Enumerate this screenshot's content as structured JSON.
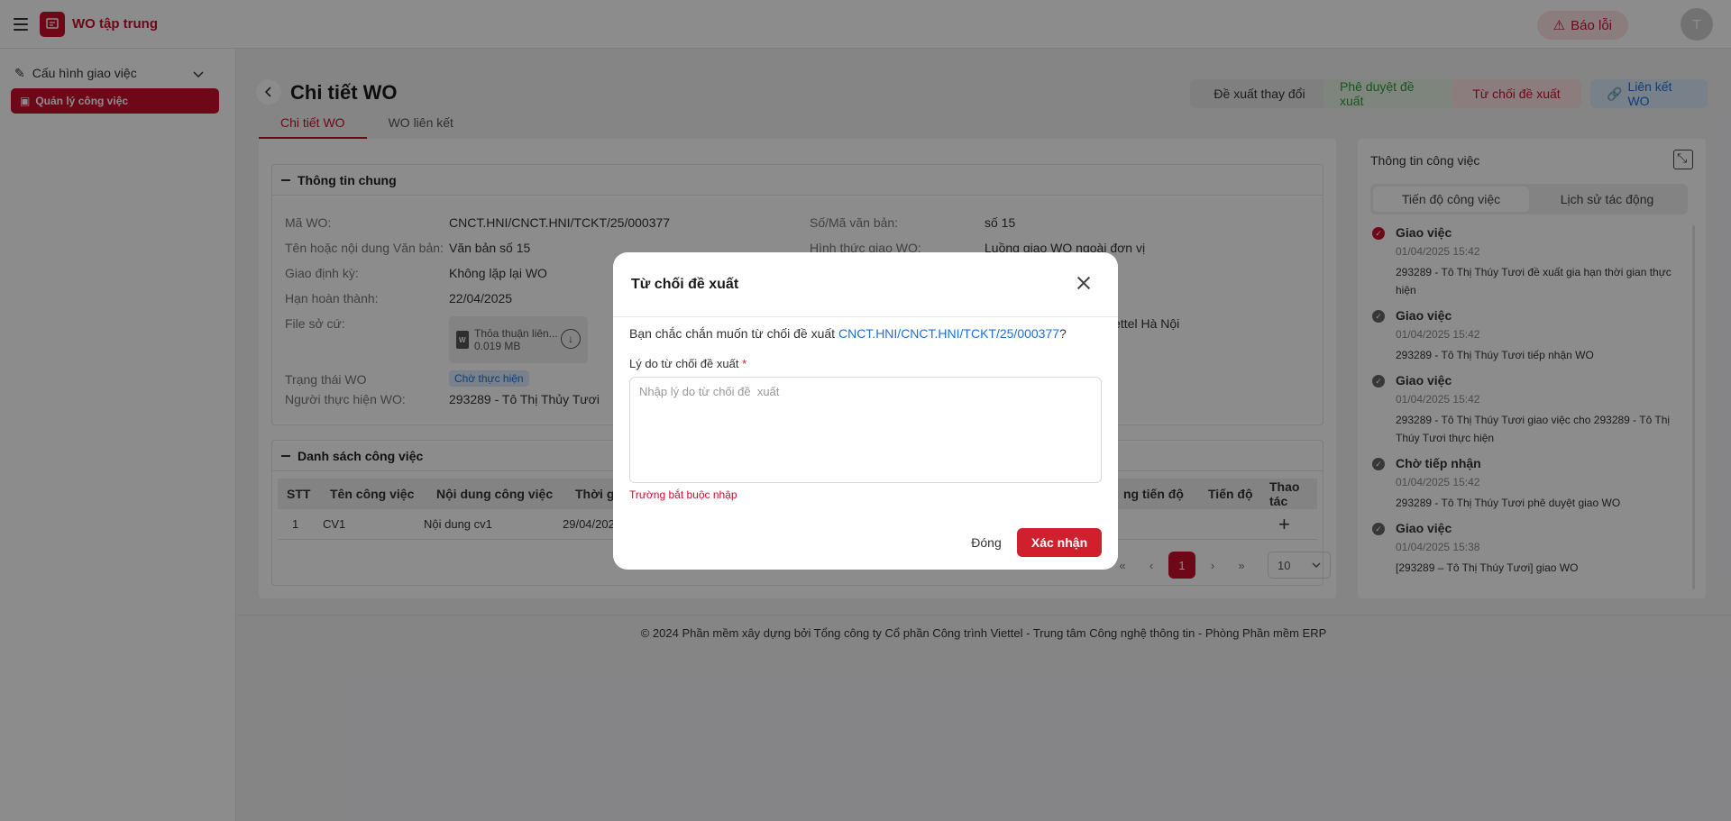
{
  "app": {
    "title": "WO tập trung",
    "report_label": "Báo lỗi",
    "avatar_initial": "T"
  },
  "sidebar": {
    "group": "Cấu hình giao việc",
    "items": [
      {
        "label": "Quản lý công việc",
        "active": true
      }
    ]
  },
  "header": {
    "title": "Chi tiết WO",
    "buttons": {
      "propose_change": "Đề xuất thay đổi",
      "approve": "Phê duyệt đề xuất",
      "reject": "Từ chối đề xuất",
      "link_wo": "Liên kết WO"
    },
    "tabs": [
      {
        "label": "Chi tiết WO",
        "active": true
      },
      {
        "label": "WO liên kết",
        "active": false
      }
    ]
  },
  "general_info": {
    "title": "Thông tin chung",
    "fields": {
      "ma_wo": {
        "label": "Mã WO:",
        "value": "CNCT.HNI/CNCT.HNI/TCKT/25/000377"
      },
      "ten_van_ban": {
        "label": "Tên hoặc nội dung Văn bản:",
        "value": "Văn bản số 15"
      },
      "giao_dinh_ky": {
        "label": "Giao định kỳ:",
        "value": "Không lặp lại WO"
      },
      "han_hoan_thanh": {
        "label": "Hạn hoàn thành:",
        "value": "22/04/2025"
      },
      "file_so_cu": {
        "label": "File sở cứ:"
      },
      "trang_thai": {
        "label": "Trạng thái WO",
        "value": "Chờ thực hiện"
      },
      "nguoi_thuc_hien": {
        "label": "Người thực hiện WO:",
        "value": "293289 - Tô Thị Thủy Tươi"
      },
      "so_van_ban": {
        "label": "Số/Mã văn bản:",
        "value": "số 15"
      },
      "hinh_thuc": {
        "label": "Hình thức giao WO:",
        "value": "Luồng giao WO ngoài đơn vị"
      },
      "don_vi_partial": {
        "value": "iettel Hà Nội"
      }
    },
    "file": {
      "name": "Thỏa thuận liên...",
      "size": "0.019 MB"
    }
  },
  "task_list": {
    "title": "Danh sách công việc",
    "columns": [
      "STT",
      "Tên công việc",
      "Nội dung công việc",
      "Thời gi",
      "ng tiến độ",
      "Tiến độ",
      "Thao tác"
    ],
    "rows": [
      {
        "stt": "1",
        "ten": "CV1",
        "noi_dung": "Nội dung cv1",
        "thoi_gian": "29/04/202"
      }
    ],
    "add_symbol": "+",
    "pager": {
      "first": "«",
      "prev": "‹",
      "current": "1",
      "next": "›",
      "last": "»",
      "page_size": "10"
    }
  },
  "right_panel": {
    "title": "Thông tin công việc",
    "tabs": [
      {
        "label": "Tiến độ công việc",
        "active": true
      },
      {
        "label": "Lịch sử tác động",
        "active": false
      }
    ],
    "timeline": [
      {
        "title": "Giao việc",
        "time": "01/04/2025 15:42",
        "desc": "293289 - Tô Thị Thúy Tươi đề xuất gia hạn thời gian thực hiện",
        "highlight": true
      },
      {
        "title": "Giao việc",
        "time": "01/04/2025 15:42",
        "desc": "293289 - Tô Thị Thúy Tươi tiếp nhận WO",
        "highlight": false
      },
      {
        "title": "Giao việc",
        "time": "01/04/2025 15:42",
        "desc": "293289 - Tô Thị Thúy Tươi giao việc cho 293289 - Tô Thị Thúy Tươi thực hiện",
        "highlight": false
      },
      {
        "title": "Chờ tiếp nhận",
        "time": "01/04/2025 15:42",
        "desc": "293289 - Tô Thị Thúy Tươi phê duyệt giao WO",
        "highlight": false
      },
      {
        "title": "Giao việc",
        "time": "01/04/2025 15:38",
        "desc": "[293289 – Tô Thị Thúy Tươi] giao WO",
        "highlight": false
      }
    ]
  },
  "footer": {
    "text": "© 2024 Phần mềm xây dựng bởi Tổng công ty Cổ phần Công trình Viettel - Trung tâm Công nghệ thông tin - Phòng Phần mềm ERP"
  },
  "modal": {
    "title": "Từ chối đề xuất",
    "confirm_prefix": "Bạn chắc chắn muốn từ chối đề xuất ",
    "confirm_link": "CNCT.HNI/CNCT.HNI/TCKT/25/000377",
    "confirm_suffix": "?",
    "reason_label": "Lý do từ chối đề xuất",
    "required_mark": "*",
    "reason_placeholder": "Nhập lý do từ chối đề  xuất",
    "reason_value": "",
    "error": "Trường bắt buộc nhập",
    "close_label": "Đóng",
    "confirm_label": "Xác nhận"
  },
  "colors": {
    "brand": "#c8102e",
    "link": "#1e6fd9",
    "success": "#2e9a3a"
  }
}
